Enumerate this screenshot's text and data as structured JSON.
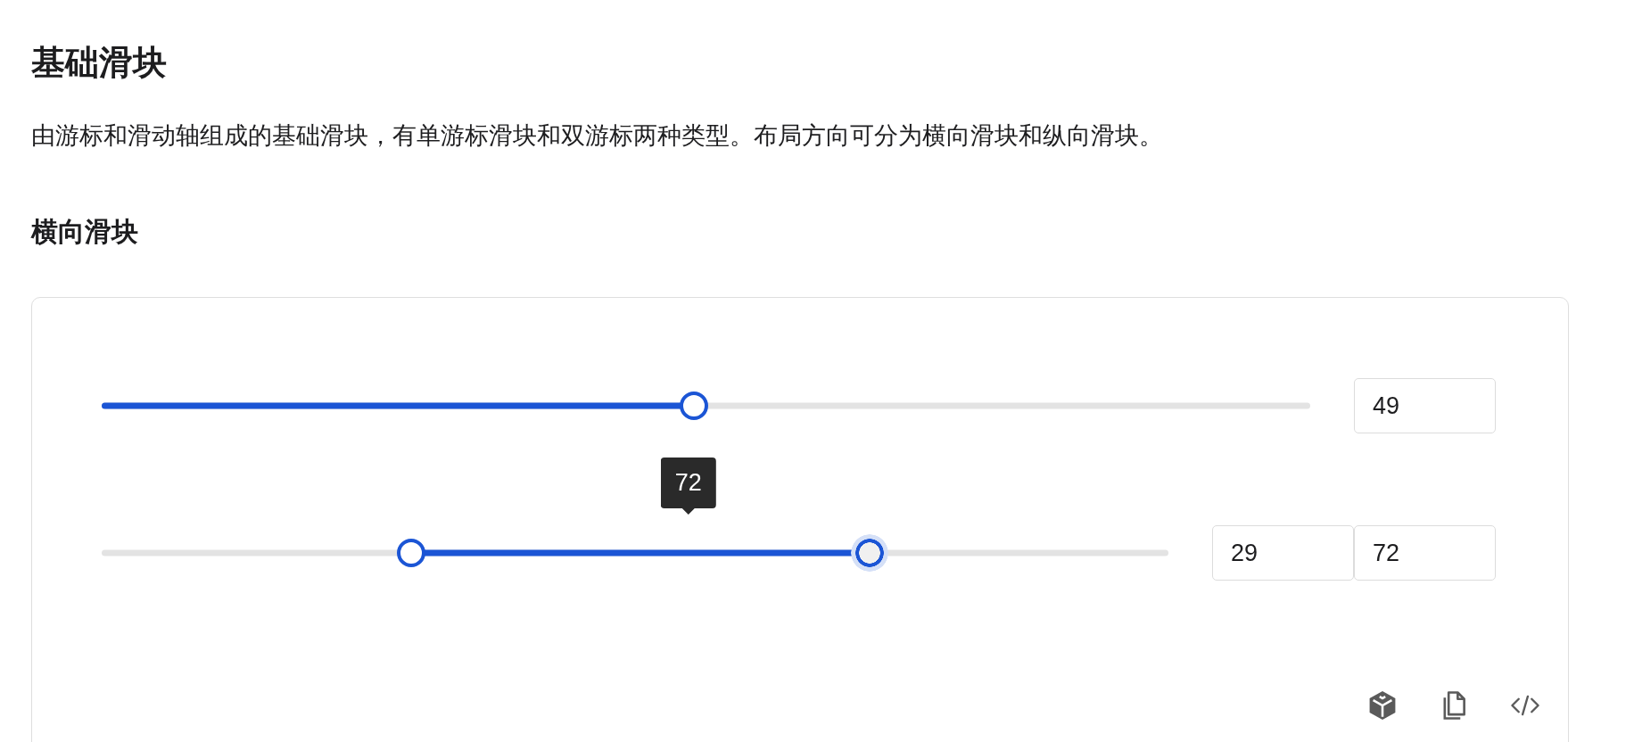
{
  "page": {
    "title": "基础滑块",
    "description": "由游标和滑动轴组成的基础滑块，有单游标滑块和双游标两种类型。布局方向可分为横向滑块和纵向滑块。"
  },
  "section": {
    "title": "横向滑块"
  },
  "demo": {
    "sliders": [
      {
        "kind": "single",
        "thumbs": [
          {
            "level": 0.49,
            "focused": false
          }
        ],
        "inputs": [
          "49"
        ]
      },
      {
        "kind": "range",
        "thumbs": [
          {
            "level": 0.29,
            "focused": false
          },
          {
            "level": 0.72,
            "focused": true
          }
        ],
        "inputs": [
          "29",
          "72"
        ],
        "tooltip": "72"
      }
    ]
  }
}
